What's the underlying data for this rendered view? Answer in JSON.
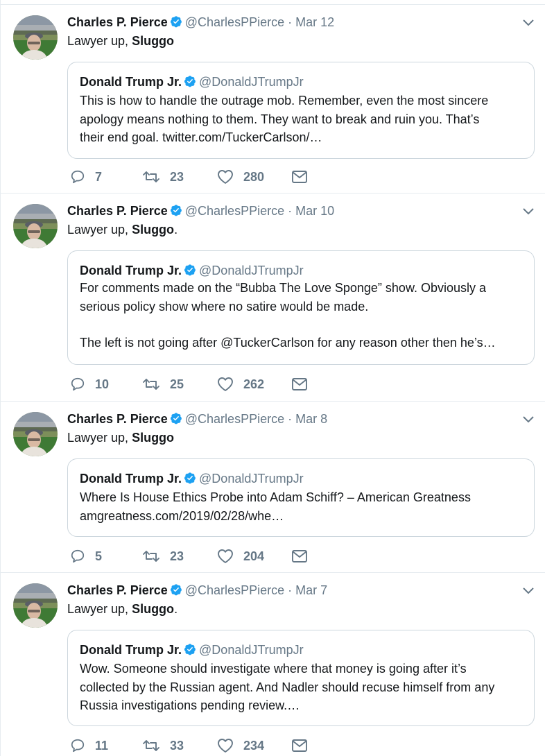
{
  "tweets": [
    {
      "author": "Charles P. Pierce",
      "handle": "@CharlesPPierce",
      "dot": "·",
      "date": "Mar 12",
      "text_plain": "Lawyer up, ",
      "text_bold": "Sluggo",
      "text_tail": "",
      "quote": {
        "author": "Donald Trump Jr.",
        "handle": "@DonaldJTrumpJr",
        "lines": [
          "This is how to handle the outrage mob. Remember, even the most sincere",
          "apology means nothing to them. They want to break and ruin you. That’s",
          "their end goal. twitter.com/TuckerCarlson/…"
        ]
      },
      "replies": "7",
      "retweets": "23",
      "likes": "280"
    },
    {
      "author": "Charles P. Pierce",
      "handle": "@CharlesPPierce",
      "dot": "·",
      "date": "Mar 10",
      "text_plain": "Lawyer up, ",
      "text_bold": "Sluggo",
      "text_tail": ".",
      "quote": {
        "author": "Donald Trump Jr.",
        "handle": "@DonaldJTrumpJr",
        "lines": [
          "For comments made on the “Bubba The Love Sponge” show. Obviously a",
          "serious policy show where no satire would be made.",
          "",
          "The left is not going after @TuckerCarlson for any reason other then he’s…"
        ]
      },
      "replies": "10",
      "retweets": "25",
      "likes": "262"
    },
    {
      "author": "Charles P. Pierce",
      "handle": "@CharlesPPierce",
      "dot": "·",
      "date": "Mar 8",
      "text_plain": "Lawyer up, ",
      "text_bold": "Sluggo",
      "text_tail": "",
      "quote": {
        "author": "Donald Trump Jr.",
        "handle": "@DonaldJTrumpJr",
        "lines": [
          "Where Is House Ethics Probe into Adam Schiff? – American Greatness",
          "amgreatness.com/2019/02/28/whe…"
        ]
      },
      "replies": "5",
      "retweets": "23",
      "likes": "204"
    },
    {
      "author": "Charles P. Pierce",
      "handle": "@CharlesPPierce",
      "dot": "·",
      "date": "Mar 7",
      "text_plain": "Lawyer up, ",
      "text_bold": "Sluggo",
      "text_tail": ".",
      "quote": {
        "author": "Donald Trump Jr.",
        "handle": "@DonaldJTrumpJr",
        "lines": [
          "Wow. Someone should investigate where that money is going after it’s",
          "collected by the Russian agent. And Nadler should recuse himself from any",
          "Russia investigations pending review.…"
        ]
      },
      "replies": "11",
      "retweets": "33",
      "likes": "234"
    }
  ],
  "icons": {
    "reply": "reply-icon",
    "retweet": "retweet-icon",
    "like": "heart-icon",
    "dm": "envelope-icon",
    "verified": "verified-badge-icon",
    "caret": "chevron-down-icon"
  },
  "colors": {
    "text": "#14171a",
    "secondary": "#657786",
    "verified": "#1da1f2",
    "border": "#e6ecf0",
    "quote_border": "#ccd6dd"
  }
}
